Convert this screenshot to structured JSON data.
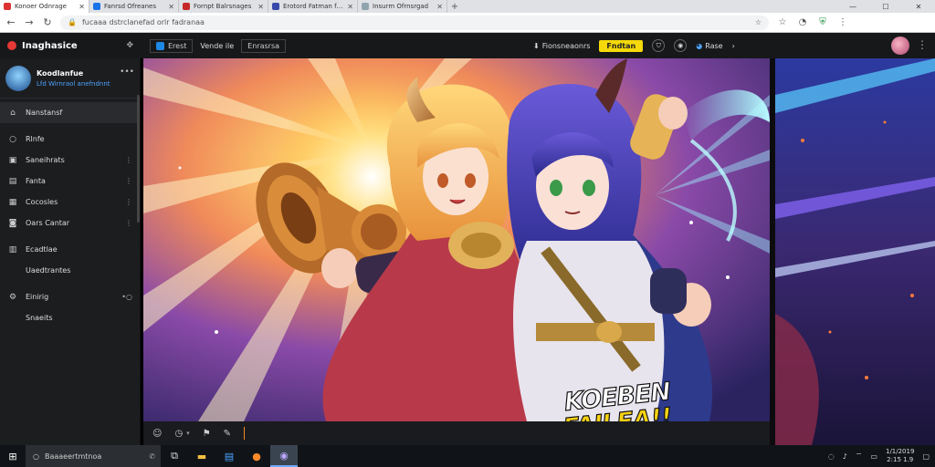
{
  "browser": {
    "tabs": [
      {
        "label": "Konoer Odnrage",
        "fav": "#d33"
      },
      {
        "label": "Fanrsd Ofreanes",
        "fav": "#1a73e8"
      },
      {
        "label": "Fornpt Balrsnages",
        "fav": "#c62828"
      },
      {
        "label": "Erotord Fatman fenars",
        "fav": "#3949ab"
      },
      {
        "label": "Insurm Ofrnsrgad",
        "fav": "#90a4ae"
      }
    ],
    "url": "fucaaa dstrclanefad orlr fadranaa"
  },
  "app": {
    "brand": "Inaghasice",
    "toolbar_left": [
      "Erest",
      "Vende ile",
      "Enrasrsa"
    ],
    "upgrade_label": "Fndtan",
    "right_label": "Fionsneaonrs",
    "share_label": "Rase"
  },
  "profile": {
    "name": "Koodlanfue",
    "sub": "Lfd Wirnraol anefndnnt"
  },
  "sidebar": {
    "items": [
      {
        "icon": "⌂",
        "label": "Nanstansf",
        "right": "",
        "active": true
      },
      {
        "icon": "○",
        "label": "Rlnfe",
        "right": "",
        "active": false
      },
      {
        "icon": "▣",
        "label": "Saneihrats",
        "right": "⋮",
        "active": false
      },
      {
        "icon": "▤",
        "label": "Fanta",
        "right": "⋮",
        "active": false
      },
      {
        "icon": "▦",
        "label": "Cocosles",
        "right": "⋮",
        "active": false
      },
      {
        "icon": "◙",
        "label": "Oars Cantar",
        "right": "⋮",
        "active": false
      },
      {
        "icon": "▥",
        "label": "Ecadtlae",
        "right": "",
        "active": false
      },
      {
        "icon": "",
        "label": "Uaedtrantes",
        "right": "",
        "active": false
      },
      {
        "icon": "⚙",
        "label": "Einirig",
        "right": "•○",
        "active": false
      },
      {
        "icon": "",
        "label": "Snaeits",
        "right": "",
        "active": false
      }
    ]
  },
  "artwork": {
    "title_line1": "KOEBEN",
    "title_line2": "FAILEA!!"
  },
  "taskbar": {
    "search_placeholder": "Baaaeertmtnoa",
    "date": "1/1/2019",
    "time": "2:15 1.9"
  },
  "colors": {
    "accent_yellow": "#f5d90a",
    "brand_red": "#e53935",
    "link_blue": "#4da3ff"
  }
}
